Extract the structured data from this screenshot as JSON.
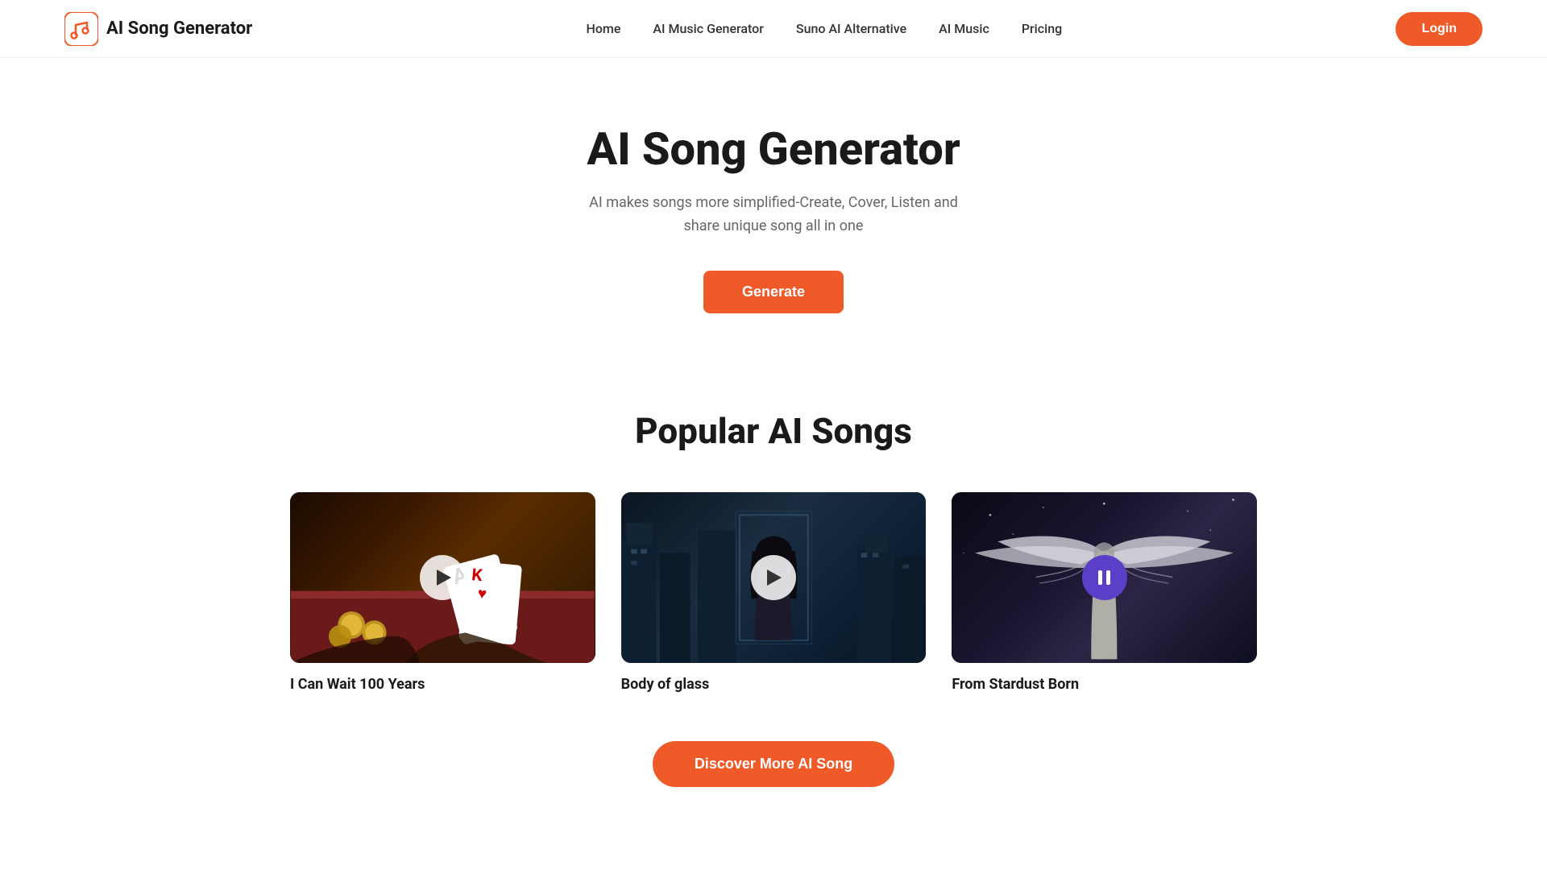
{
  "brand": {
    "name": "AI Song Generator"
  },
  "nav": {
    "links": [
      {
        "label": "Home",
        "href": "#"
      },
      {
        "label": "AI Music Generator",
        "href": "#"
      },
      {
        "label": "Suno AI Alternative",
        "href": "#"
      },
      {
        "label": "AI Music",
        "href": "#"
      },
      {
        "label": "Pricing",
        "href": "#"
      }
    ],
    "login_label": "Login"
  },
  "hero": {
    "title": "AI Song Generator",
    "subtitle_line1": "AI makes songs more simplified-Create, Cover, Listen and",
    "subtitle_line2": "share unique song all in one",
    "generate_label": "Generate"
  },
  "popular": {
    "section_title": "Popular AI Songs",
    "songs": [
      {
        "title": "I Can Wait 100 Years",
        "playing": false
      },
      {
        "title": "Body of glass",
        "playing": false
      },
      {
        "title": "From Stardust Born",
        "playing": true
      }
    ],
    "discover_label": "Discover More AI Song"
  }
}
